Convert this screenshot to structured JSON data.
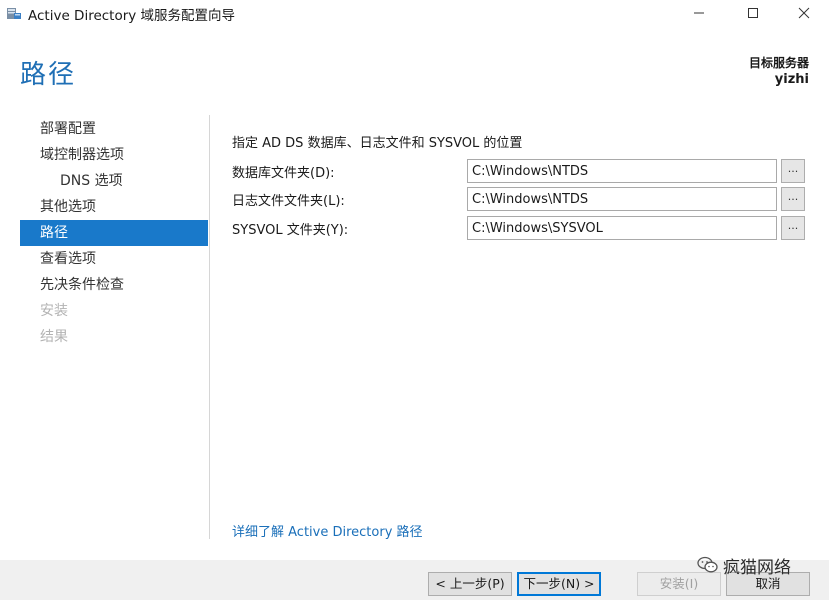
{
  "window": {
    "title": "Active Directory 域服务配置向导",
    "icon": "ad-server-icon",
    "controls": {
      "minimize": "minimize-icon",
      "maximize": "maximize-icon",
      "close": "close-icon"
    }
  },
  "header": {
    "page_title": "路径",
    "target_label": "目标服务器",
    "target_server": "yizhi"
  },
  "nav": {
    "items": [
      {
        "label": "部署配置",
        "state": "normal"
      },
      {
        "label": "域控制器选项",
        "state": "normal"
      },
      {
        "label": "DNS 选项",
        "state": "normal"
      },
      {
        "label": "其他选项",
        "state": "normal"
      },
      {
        "label": "路径",
        "state": "active"
      },
      {
        "label": "查看选项",
        "state": "normal"
      },
      {
        "label": "先决条件检查",
        "state": "normal"
      },
      {
        "label": "安装",
        "state": "disabled"
      },
      {
        "label": "结果",
        "state": "disabled"
      }
    ]
  },
  "main": {
    "section_title": "指定 AD DS 数据库、日志文件和 SYSVOL 的位置",
    "fields": [
      {
        "label": "数据库文件夹(D):",
        "value": "C:\\Windows\\NTDS",
        "browse": "..."
      },
      {
        "label": "日志文件文件夹(L):",
        "value": "C:\\Windows\\NTDS",
        "browse": "..."
      },
      {
        "label": "SYSVOL 文件夹(Y):",
        "value": "C:\\Windows\\SYSVOL",
        "browse": "..."
      }
    ],
    "learn_more": "详细了解 Active Directory 路径"
  },
  "buttons": {
    "prev": "< 上一步(P)",
    "next": "下一步(N) >",
    "install": "安装(I)",
    "cancel": "取消"
  },
  "watermark": {
    "text": "疯猫网络",
    "icon": "wechat-icon"
  },
  "colors": {
    "accent": "#1979ca",
    "title": "#1f6fb5",
    "link": "#1a6fb9"
  }
}
